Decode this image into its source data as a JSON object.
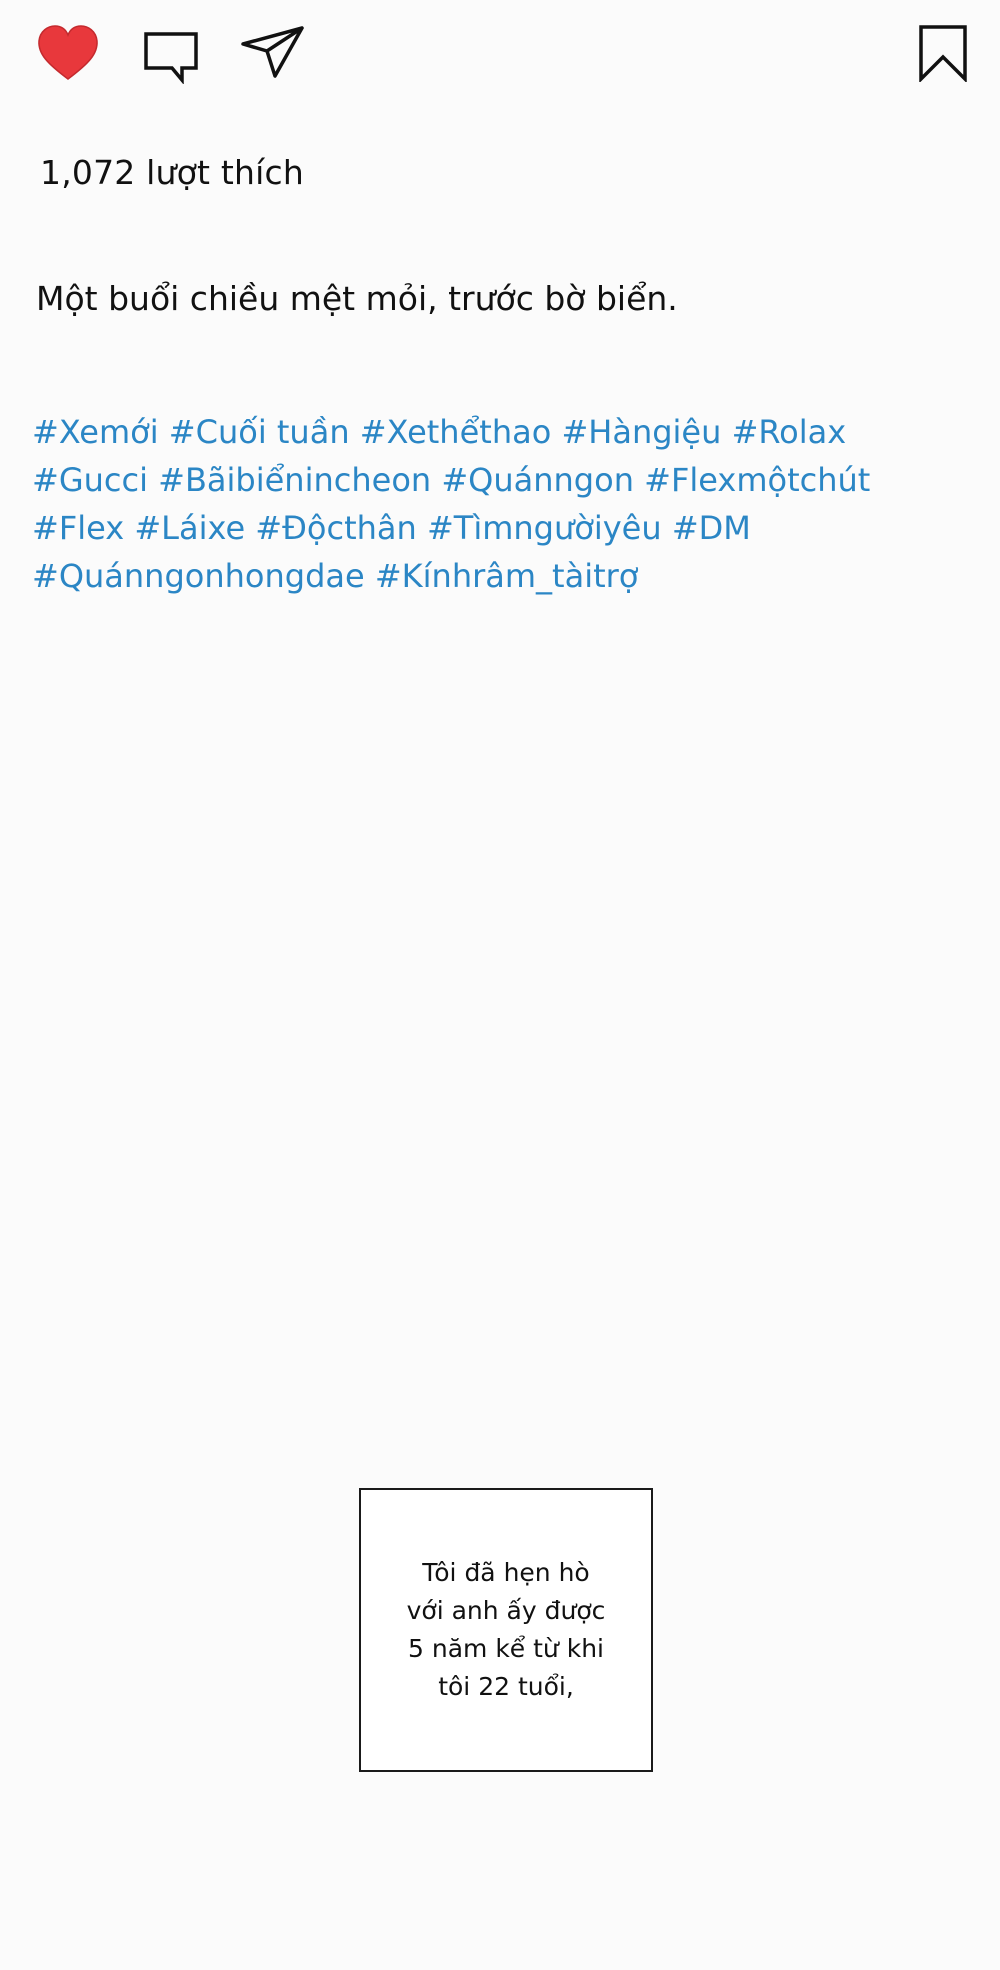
{
  "actions": {
    "icons": [
      "heart-icon",
      "comment-icon",
      "send-icon",
      "bookmark-icon"
    ],
    "like_color": "#e8383c"
  },
  "post": {
    "likes_text": "1,072 lượt thích",
    "caption": "Một buổi chiều mệt mỏi, trước bờ biển.",
    "hashtag_color": "#2b86c5",
    "hashtags": [
      "#Xemới",
      "#Cuối tuần",
      "#Xethểthao",
      "#Hàngiệu",
      "#Rolax",
      "#Gucci",
      "#Bãibiểnincheon",
      "#Quánngon",
      "#Flexmộtchút",
      "#Flex",
      "#Láixe",
      "#Độcthân",
      "#Tìmngườiyêu",
      "#DM",
      "#Quánngonhongdae",
      "#Kínhrâm_tàitrợ"
    ]
  },
  "narration": {
    "lines": [
      "Tôi đã hẹn hò",
      "với anh ấy được",
      "5 năm kể từ khi",
      "tôi 22 tuổi,"
    ]
  }
}
